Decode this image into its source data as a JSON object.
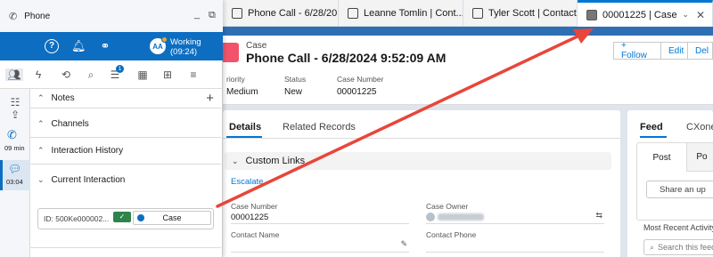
{
  "tabs": [
    {
      "label": "Phone Call - 6/28/20...",
      "type": "x"
    },
    {
      "label": "Leanne Tomlin | Cont...",
      "type": "x"
    },
    {
      "label": "Tyler Scott | Contact",
      "type": "x"
    },
    {
      "label": "00001225 | Case",
      "type": "chev"
    }
  ],
  "record": {
    "type": "Case",
    "title": "Phone Call - 6/28/2024 9:52:09 AM",
    "buttons": [
      "+ Follow",
      "Edit",
      "Del"
    ],
    "fields": [
      {
        "label": "riority",
        "value": "Medium"
      },
      {
        "label": "Status",
        "value": "New"
      },
      {
        "label": "Case Number",
        "value": "00001225"
      }
    ]
  },
  "details": {
    "tabs": [
      "Details",
      "Related Records"
    ],
    "section": "Custom Links",
    "escalate": "Escalate",
    "fields": [
      {
        "label": "Case Number",
        "value": "00001225"
      },
      {
        "label": "Case Owner",
        "value": ""
      },
      {
        "label": "Contact Name",
        "value": ""
      },
      {
        "label": "Contact Phone",
        "value": ""
      }
    ]
  },
  "feed": {
    "tabs": [
      "Feed",
      "CXone"
    ],
    "post_tabs": [
      "Post",
      "Po"
    ],
    "share": "Share an up",
    "most_recent": "Most Recent Activity",
    "search_placeholder": "Search this feed..."
  },
  "phone": {
    "title": "Phone",
    "agent_initials": "AA",
    "status": "Working",
    "status_time": "(09:24)",
    "notification_count": "1",
    "call_time": "09 min",
    "chat_time": "03:04",
    "sections": [
      "Notes",
      "Channels",
      "Interaction History",
      "Current Interaction"
    ],
    "current_interaction_id": "ID: 500Ke000002...",
    "case_label": "Case"
  },
  "colors": {
    "brand_blue": "#0d6ec1",
    "salesforce_blue": "#0176d3",
    "arrow_red": "#e8463a",
    "success_green": "#2e844a"
  }
}
